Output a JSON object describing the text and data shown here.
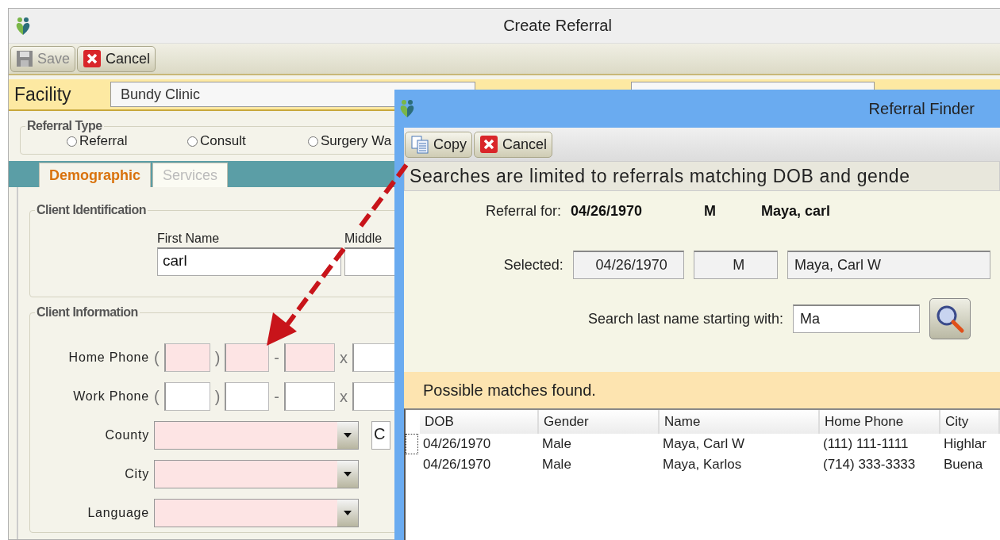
{
  "window": {
    "title": "Create Referral"
  },
  "toolbar": [
    {
      "label": "Save",
      "kind": "save",
      "disabled": true
    },
    {
      "label": "Cancel",
      "kind": "cancel",
      "disabled": false
    }
  ],
  "facility": {
    "label": "Facility",
    "value": "Bundy Clinic"
  },
  "referral_type": {
    "title": "Referral Type",
    "options": [
      {
        "label": "Referral",
        "selected": false
      },
      {
        "label": "Consult",
        "selected": false
      },
      {
        "label": "Surgery Wa",
        "selected": false
      }
    ]
  },
  "tabs": [
    {
      "label": "Demographic",
      "selected": true
    },
    {
      "label": "Services",
      "selected": false
    }
  ],
  "client_identification": {
    "title": "Client Identification",
    "first_name": {
      "label": "First Name",
      "value": "carl"
    },
    "middle": {
      "label": "Middle"
    }
  },
  "client_information": {
    "title": "Client Information",
    "phones": [
      {
        "label": "Home Phone",
        "required": true,
        "parts": [
          "(",
          ")",
          "-",
          "x"
        ]
      },
      {
        "label": "Work Phone",
        "required": false,
        "parts": [
          "(",
          ")",
          "-",
          "x"
        ]
      }
    ],
    "selects": [
      {
        "label": "County",
        "required": true,
        "side_value": "C"
      },
      {
        "label": "City",
        "required": true
      },
      {
        "label": "Language",
        "required": true
      }
    ]
  },
  "finder": {
    "title": "Referral Finder",
    "toolbar": [
      {
        "label": "Copy",
        "kind": "copy"
      },
      {
        "label": "Cancel",
        "kind": "cancel"
      }
    ],
    "notice": "Searches are limited to referrals matching DOB and gende",
    "referral_for": {
      "label": "Referral for:",
      "dob": "04/26/1970",
      "gender": "M",
      "name": "Maya, carl"
    },
    "selected": {
      "label": "Selected:",
      "dob": "04/26/1970",
      "gender": "M",
      "name": "Maya, Carl W"
    },
    "search": {
      "label": "Search last name starting with:",
      "value": "Ma"
    },
    "status": "Possible matches found.",
    "table": {
      "columns": [
        "DOB",
        "Gender",
        "Name",
        "Home Phone",
        "City"
      ],
      "rows": [
        {
          "focused": true,
          "cells": [
            "04/26/1970",
            "Male",
            "Maya, Carl W",
            "(111) 111-1111",
            "Highlar"
          ]
        },
        {
          "focused": false,
          "cells": [
            "04/26/1970",
            "Male",
            "Maya, Karlos",
            "(714) 333-3333",
            "Buena"
          ]
        }
      ]
    }
  }
}
